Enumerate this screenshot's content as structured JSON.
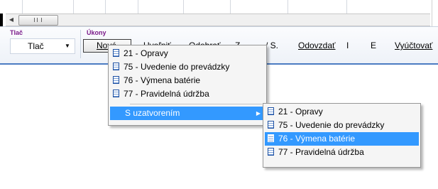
{
  "ribbon": {
    "group_print_label": "Tlač",
    "group_actions_label": "Úkony",
    "print_select_value": "Tlač",
    "buttons": {
      "nove": "Nové",
      "uvolnit": "Uvoľniť",
      "odobrat": "Odobrať",
      "z": "Z",
      "ws": "/ S.",
      "odovzdat": "Odovzdať",
      "i": "I",
      "e": "E",
      "vyuctovat": "Vyúčtovať"
    }
  },
  "menu": {
    "items": [
      {
        "label": "21 - Opravy"
      },
      {
        "label": "75 - Uvedenie do prevádzky"
      },
      {
        "label": "76 - Výmena batérie"
      },
      {
        "label": "77 - Pravidelná údržba"
      }
    ],
    "submenu_parent": "S uzatvorením"
  },
  "submenu": {
    "items": [
      {
        "label": "21 - Opravy"
      },
      {
        "label": "75 - Uvedenie do prevádzky"
      },
      {
        "label": "76 - Výmena batérie"
      },
      {
        "label": "77 - Pravidelná údržba"
      }
    ],
    "highlighted_index": 2
  },
  "colors": {
    "group_label": "#7b1b8a",
    "highlight": "#3399ff",
    "ribbon_accent": "#4c7cc2"
  }
}
